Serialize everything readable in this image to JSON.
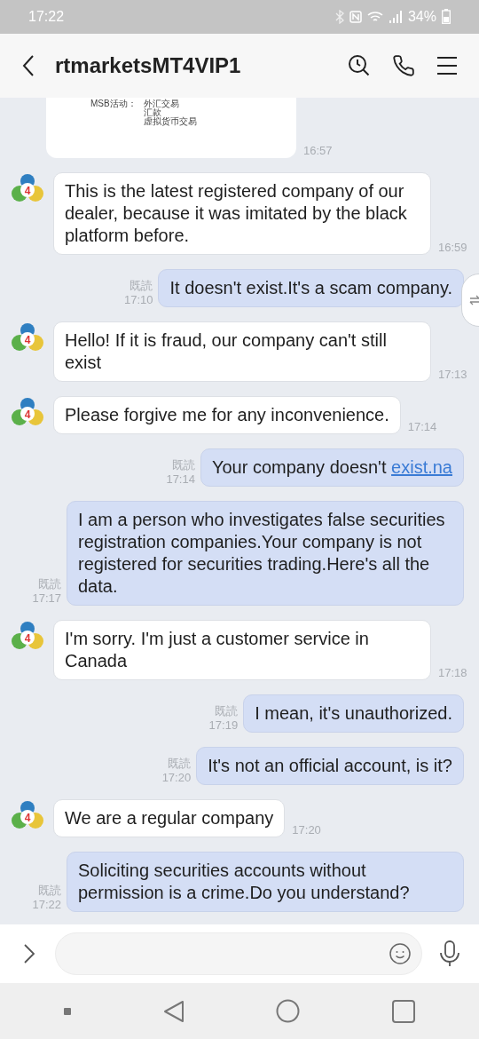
{
  "status_bar": {
    "time": "17:22",
    "battery": "34%"
  },
  "header": {
    "title": "rtmarketsMT4VIP1"
  },
  "messages": [
    {
      "kind": "image",
      "lines": [
        {
          "label": "MSB活动：",
          "values": [
            "外汇交易",
            "汇款",
            "虚拟货币交易"
          ]
        }
      ],
      "time": "16:57"
    },
    {
      "kind": "received",
      "avatar_badge": "4",
      "text": "This is the latest registered company of our dealer, because it was imitated by the black platform before.",
      "time": "16:59"
    },
    {
      "kind": "sent",
      "read": "既読",
      "text": "It doesn't exist.It's a scam company.",
      "time": "17:10"
    },
    {
      "kind": "received",
      "avatar_badge": "4",
      "text": "Hello! If it is fraud, our company can't still exist",
      "time": "17:13"
    },
    {
      "kind": "received",
      "avatar_badge": "4",
      "text": "Please forgive me for any inconvenience.",
      "time": "17:14"
    },
    {
      "kind": "sent",
      "read": "既読",
      "text": "Your company doesn't ",
      "link": "exist.na",
      "time": "17:14"
    },
    {
      "kind": "sent",
      "read": "既読",
      "text": "I am a person who investigates false securities registration companies.Your company is not registered for securities trading.Here's all the data.",
      "time": "17:17"
    },
    {
      "kind": "received",
      "avatar_badge": "4",
      "text": "I'm sorry. I'm just a customer service in Canada",
      "time": "17:18"
    },
    {
      "kind": "sent",
      "read": "既読",
      "text": "I mean, it's unauthorized.",
      "time": "17:19"
    },
    {
      "kind": "sent",
      "read": "既読",
      "text": "It's not an official account, is it?",
      "time": "17:20"
    },
    {
      "kind": "received",
      "avatar_badge": "4",
      "text": "We are a regular company",
      "time": "17:20"
    },
    {
      "kind": "sent",
      "read": "既読",
      "text": "Soliciting securities accounts without permission is a crime.Do you understand?",
      "time": "17:22"
    }
  ]
}
